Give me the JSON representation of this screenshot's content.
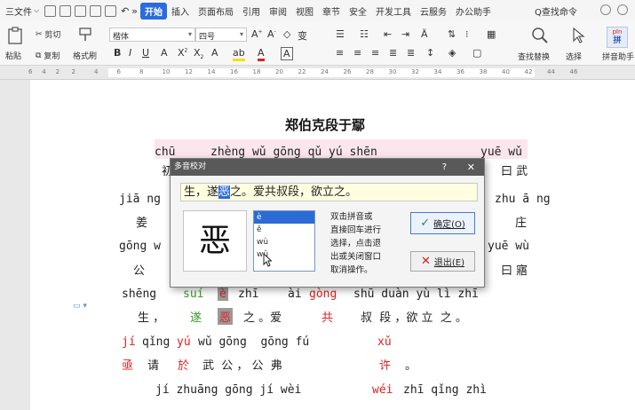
{
  "menubar": {
    "file_label": "三文件",
    "tabs": [
      "开始",
      "插入",
      "页面布局",
      "引用",
      "审阅",
      "视图",
      "章节",
      "安全",
      "开发工具",
      "云服务",
      "办公助手"
    ],
    "active_tab": "开始",
    "search_label": "Q查找命令"
  },
  "ribbon": {
    "paste_label": "粘贴",
    "cut_label": "剪切",
    "copy_label": "复制",
    "format_painter_label": "格式刷",
    "font_name": "楷体",
    "font_size": "四号",
    "find_replace_label": "查找替换",
    "select_label": "选择",
    "pinyin_label": "拼音助手",
    "pinyin_icon_text": "pīn"
  },
  "ruler": {
    "ticks": [
      "6",
      "4",
      "2",
      "2",
      "4",
      "6",
      "8",
      "10",
      "12",
      "14",
      "16",
      "18",
      "20",
      "22",
      "24",
      "26",
      "28",
      "30",
      "32",
      "34",
      "36",
      "38",
      "40",
      "42",
      "44",
      "46"
    ]
  },
  "document": {
    "title": "郑伯克段于鄢",
    "l1_py_a": "chū",
    "l1_py_b": "zhèng wǔ gōng qǔ yú shēn",
    "l1_py_c": "yuē wǔ",
    "l1_hz_a": "初",
    "l1_hz_c": "曰 武",
    "l2_py_a": "jiā ng",
    "l2_py_c": "zhu ā ng",
    "l2_hz_a": "姜",
    "l2_hz_c": "庄",
    "l3_py_a": "gōng w",
    "l3_py_c": "yuē wù",
    "l3_hz_a": "公",
    "l3_hz_c": "曰 寤",
    "l4_py_a": "shēng",
    "l4_py_b": "suí",
    "l4_py_c": "è",
    "l4_py_d": "zhī",
    "l4_py_e": "ài",
    "l4_py_f": "gòng",
    "l4_py_g": "shū duàn yù lì zhī",
    "l4_hz_a": "生 ，",
    "l4_hz_b": "遂",
    "l4_hz_c": "恶",
    "l4_hz_d": "之 。爱",
    "l4_hz_e": "共",
    "l4_hz_f": "叔  段 ，欲 立  之 。",
    "l5_py_a": "jí",
    "l5_py_b": "qǐng",
    "l5_py_c": "yú",
    "l5_py_d": "wǔ gōng  gōng fú",
    "l5_py_e": "xǔ",
    "l5_hz_a": "亟",
    "l5_hz_b": "请",
    "l5_hz_c": "於",
    "l5_hz_d": "武  公 ， 公  弗",
    "l5_hz_e": "许",
    "l5_hz_f": "。",
    "l6_py_a": "jí zhuāng gōng jí wèi",
    "l6_py_b": "wéi",
    "l6_py_c": "zhī qǐng zhì"
  },
  "dialog": {
    "title": "多音校对",
    "help_glyph": "?",
    "close_glyph": "✕",
    "sentence_before": "生，遂",
    "sentence_highlight": "恶",
    "sentence_after": "之。爱共叔段，欲立之。",
    "big_char": "恶",
    "options": [
      "è",
      "ě",
      "wù",
      "wū"
    ],
    "selected_option": 0,
    "help_text_1": "双击拼音或",
    "help_text_2": "直接回车进行",
    "help_text_3": "选择，点击退",
    "help_text_4": "出或关闭窗口",
    "help_text_5": "取消操作。",
    "ok_label": "确定(O)",
    "exit_label": "退出(E)"
  },
  "colors": {
    "accent": "#2b6be0",
    "red_text": "#e02020",
    "green_text": "#3a9a2a",
    "dialog_title_bg": "#595959"
  }
}
